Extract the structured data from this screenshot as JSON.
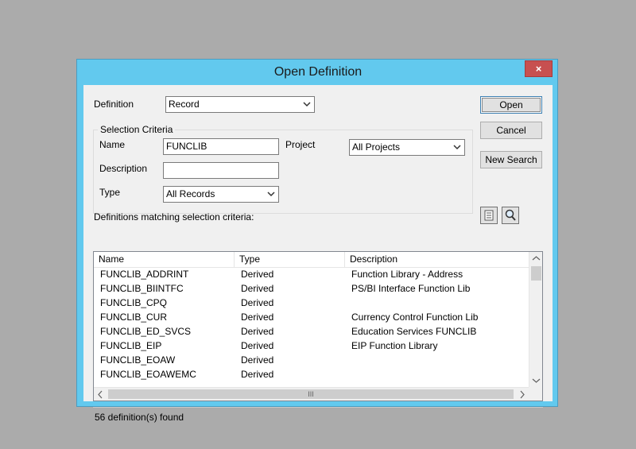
{
  "dialog": {
    "title": "Open Definition",
    "close_label": "×"
  },
  "definition": {
    "label": "Definition",
    "value": "Record"
  },
  "buttons": {
    "open": "Open",
    "cancel": "Cancel",
    "new_search": "New Search"
  },
  "selection_criteria": {
    "title": "Selection Criteria",
    "name_label": "Name",
    "name_value": "FUNCLIB",
    "project_label": "Project",
    "project_value": "All Projects",
    "description_label": "Description",
    "description_value": "",
    "type_label": "Type",
    "type_value": "All Records"
  },
  "results": {
    "label": "Definitions matching selection criteria:",
    "columns": [
      "Name",
      "Type",
      "Description"
    ],
    "rows": [
      {
        "name": "FUNCLIB_ADDRINT",
        "type": "Derived",
        "description": "Function Library - Address"
      },
      {
        "name": "FUNCLIB_BIINTFC",
        "type": "Derived",
        "description": "PS/BI Interface Function Lib"
      },
      {
        "name": "FUNCLIB_CPQ",
        "type": "Derived",
        "description": ""
      },
      {
        "name": "FUNCLIB_CUR",
        "type": "Derived",
        "description": "Currency Control Function Lib"
      },
      {
        "name": "FUNCLIB_ED_SVCS",
        "type": "Derived",
        "description": "Education Services FUNCLIB"
      },
      {
        "name": "FUNCLIB_EIP",
        "type": "Derived",
        "description": "EIP Function Library"
      },
      {
        "name": "FUNCLIB_EOAW",
        "type": "Derived",
        "description": ""
      },
      {
        "name": "FUNCLIB_EOAWEMC",
        "type": "Derived",
        "description": ""
      }
    ],
    "scroll_glyph": "III"
  },
  "status": "56 definition(s) found",
  "icons": {
    "list_view": "list-view-icon",
    "search": "magnifier-icon"
  },
  "colors": {
    "title_bar": "#62c9ee",
    "close": "#c75050",
    "background": "#ababab"
  }
}
